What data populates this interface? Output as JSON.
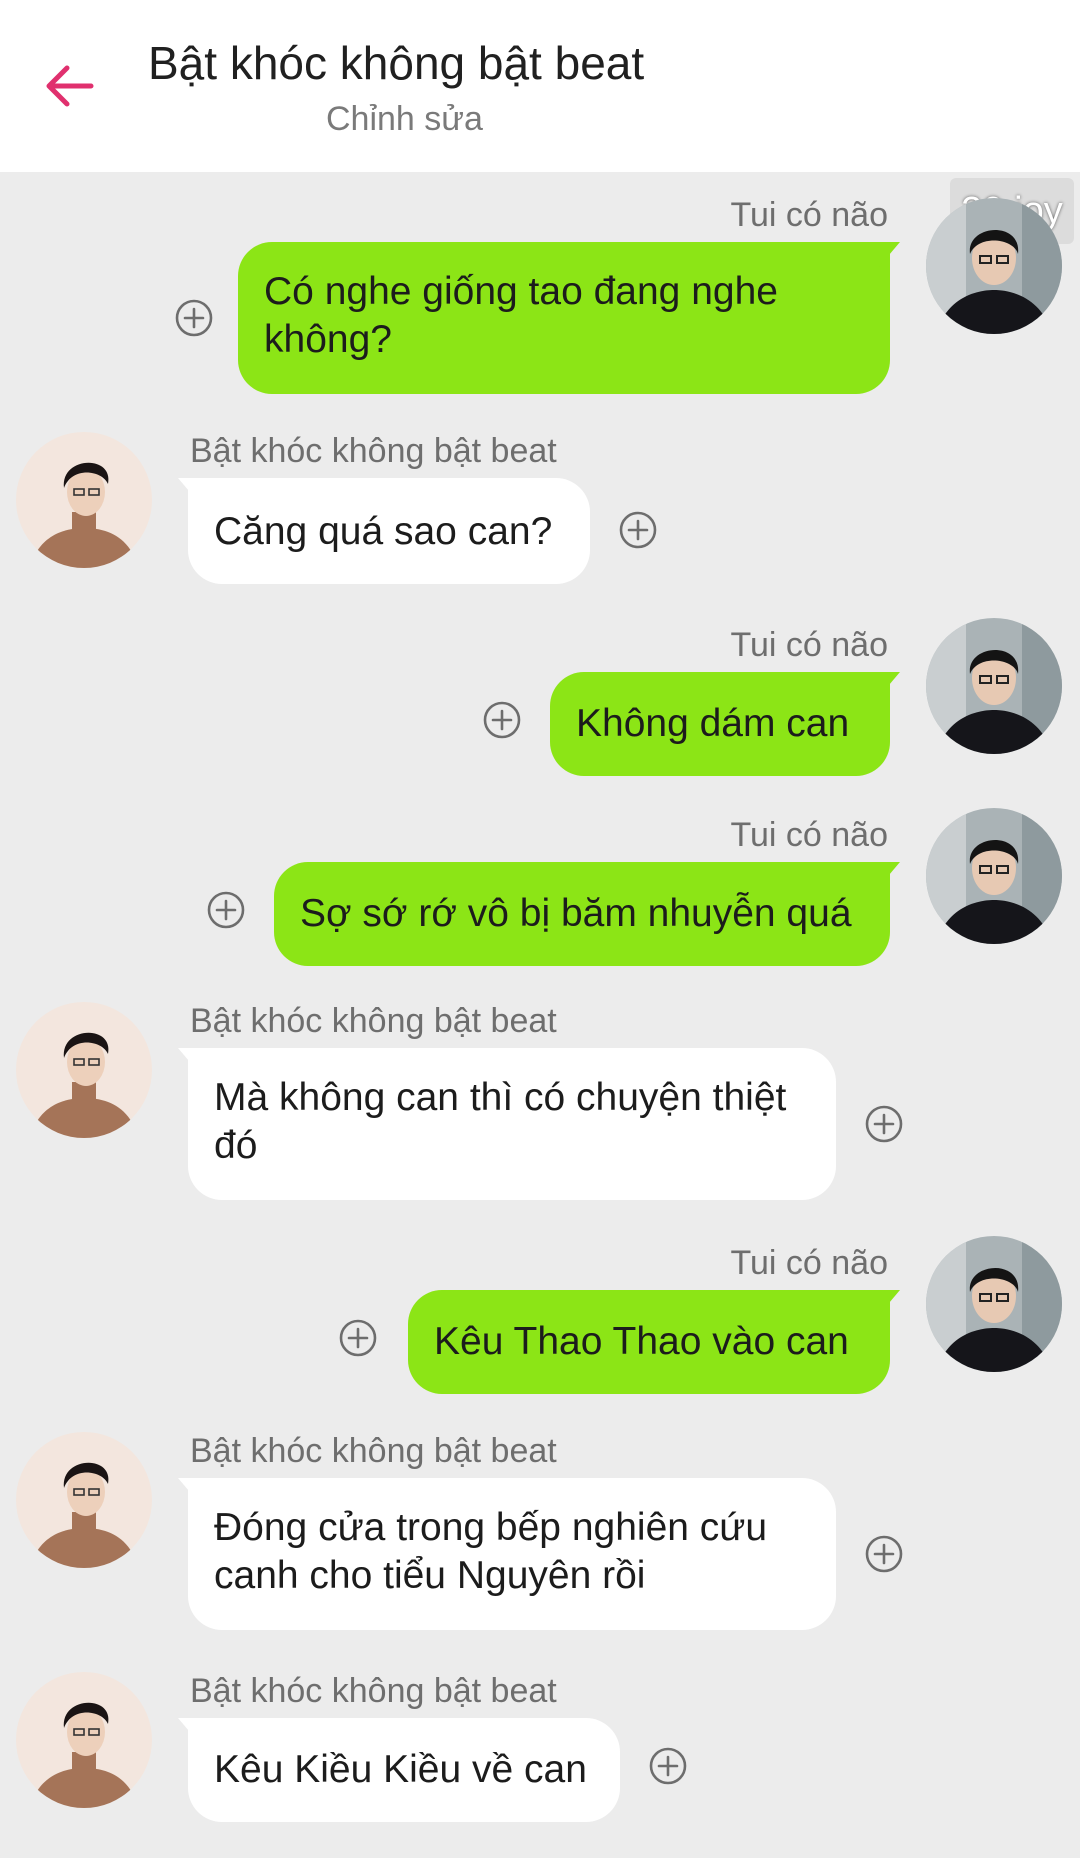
{
  "header": {
    "title": "Bật khóc không bật beat",
    "subtitle": "Chỉnh sửa"
  },
  "watermark": "30 joy",
  "colors": {
    "accent": "#e0306e",
    "sent_bubble": "#8ce516",
    "received_bubble": "#ffffff",
    "background": "#ececec"
  },
  "messages": [
    {
      "side": "sent",
      "sender": "Tui có não",
      "text": "Có nghe giống tao đang nghe không?"
    },
    {
      "side": "received",
      "sender": "Bật khóc không bật beat",
      "text": "Căng quá sao can?"
    },
    {
      "side": "sent",
      "sender": "Tui có não",
      "text": "Không dám can"
    },
    {
      "side": "sent",
      "sender": "Tui có não",
      "text": "Sợ sớ rớ vô bị băm nhuyễn quá"
    },
    {
      "side": "received",
      "sender": "Bật khóc không bật beat",
      "text": "Mà không can thì có chuyện thiệt đó"
    },
    {
      "side": "sent",
      "sender": "Tui có não",
      "text": "Kêu Thao Thao vào can"
    },
    {
      "side": "received",
      "sender": "Bật khóc không bật beat",
      "text": "Đóng cửa trong bếp nghiên cứu canh cho tiểu Nguyên rồi"
    },
    {
      "side": "received",
      "sender": "Bật khóc không bật beat",
      "text": "Kêu Kiều Kiều về can"
    }
  ]
}
